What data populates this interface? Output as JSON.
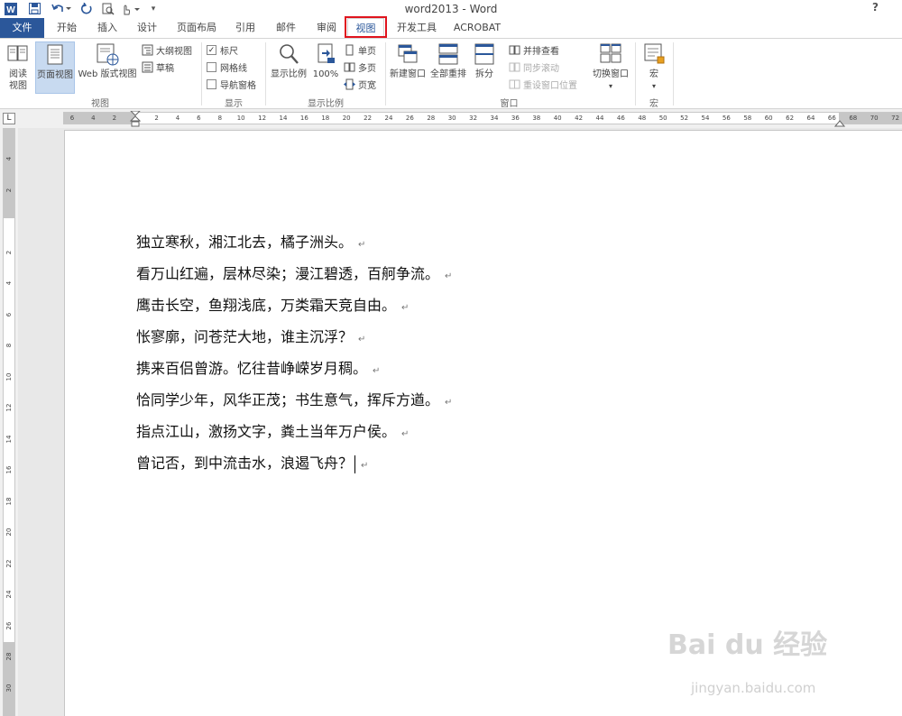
{
  "window": {
    "title": "word2013 - Word",
    "help": "?"
  },
  "tabs": [
    {
      "label": "文件"
    },
    {
      "label": "开始"
    },
    {
      "label": "插入"
    },
    {
      "label": "设计"
    },
    {
      "label": "页面布局"
    },
    {
      "label": "引用"
    },
    {
      "label": "邮件"
    },
    {
      "label": "审阅"
    },
    {
      "label": "视图"
    },
    {
      "label": "开发工具"
    },
    {
      "label": "ACROBAT"
    }
  ],
  "ribbon": {
    "views": {
      "label": "视图",
      "read_mode": "阅读\n视图",
      "print_layout": "页面视图",
      "web_layout": "Web 版式视图",
      "outline": "大纲视图",
      "draft": "草稿"
    },
    "show": {
      "label": "显示",
      "ruler": "标尺",
      "ruler_checked": true,
      "gridlines": "网格线",
      "gridlines_checked": false,
      "nav_pane": "导航窗格",
      "nav_pane_checked": false
    },
    "zoom": {
      "label": "显示比例",
      "zoom": "显示比例",
      "hundred": "100%",
      "one_page": "单页",
      "multi_page": "多页",
      "page_width": "页宽"
    },
    "window": {
      "label": "窗口",
      "new_window": "新建窗口",
      "arrange_all": "全部重排",
      "split": "拆分",
      "side_by_side": "并排查看",
      "sync_scroll": "同步滚动",
      "reset_position": "重设窗口位置",
      "switch_windows": "切换窗口"
    },
    "macros": {
      "label": "宏",
      "macros": "宏"
    }
  },
  "ruler": {
    "h_labels": [
      "6",
      "4",
      "2",
      "",
      "2",
      "4",
      "6",
      "8",
      "10",
      "12",
      "14",
      "16",
      "18",
      "20",
      "22",
      "24",
      "26",
      "28",
      "30",
      "32",
      "34",
      "36",
      "38",
      "40",
      "42",
      "44",
      "46",
      "48",
      "50",
      "52",
      "54",
      "56",
      "58",
      "60",
      "62",
      "64",
      "66",
      "68",
      "70",
      "72"
    ],
    "v_labels": [
      "4",
      "2",
      "",
      "2",
      "4",
      "6",
      "8",
      "10",
      "12",
      "14",
      "16",
      "18",
      "20",
      "22",
      "24",
      "26",
      "28",
      "30"
    ],
    "corner": "L"
  },
  "document": {
    "lines": [
      "独立寒秋，湘江北去，橘子洲头。",
      "看万山红遍，层林尽染；漫江碧透，百舸争流。",
      "鹰击长空，鱼翔浅底，万类霜天竞自由。",
      "怅寥廓，问苍茫大地，谁主沉浮？",
      "携来百侣曾游。忆往昔峥嵘岁月稠。",
      "恰同学少年，风华正茂；书生意气，挥斥方遒。",
      "指点江山，激扬文字，粪土当年万户侯。",
      "曾记否，到中流击水，浪遏飞舟？"
    ],
    "paragraph_mark": "↵"
  },
  "watermark": {
    "logo": "Bai du 经验",
    "url": "jingyan.baidu.com"
  },
  "colors": {
    "accent": "#2b579a",
    "highlight": "#e0141e"
  }
}
